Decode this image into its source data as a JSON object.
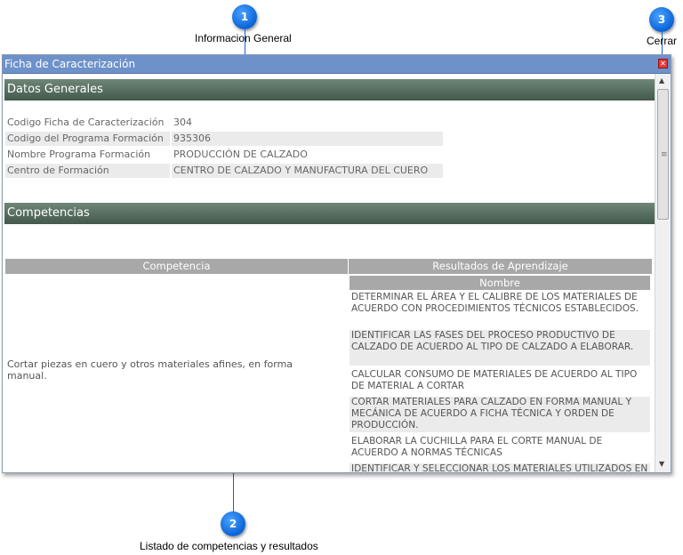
{
  "callouts": [
    {
      "number": "1",
      "label": "Informacion General"
    },
    {
      "number": "2",
      "label": "Listado de competencias y resultados"
    },
    {
      "number": "3",
      "label": "Cerrar"
    }
  ],
  "window": {
    "title": "Ficha de Caracterización",
    "close_glyph": "✕"
  },
  "datos_generales": {
    "header": "Datos Generales",
    "rows": [
      {
        "label": "Codigo Ficha de Caracterización",
        "value": "304"
      },
      {
        "label": "Codigo del Programa Formación",
        "value": "935306"
      },
      {
        "label": "Nombre Programa Formación",
        "value": "PRODUCCIÓN DE CALZADO"
      },
      {
        "label": "Centro de Formación",
        "value": "CENTRO DE CALZADO Y MANUFACTURA DEL CUERO"
      }
    ]
  },
  "competencias": {
    "header": "Competencias",
    "col_competencia": "Competencia",
    "col_resultados": "Resultados de Aprendizaje",
    "sub_col_nombre": "Nombre",
    "competencia": "Cortar piezas en cuero y otros materiales afines, en forma manual.",
    "resultados": [
      "DETERMINAR EL ÁREA Y EL CALIBRE DE LOS MATERIALES DE ACUERDO CON PROCEDIMIENTOS TÉCNICOS ESTABLECIDOS.",
      "IDENTIFICAR LAS FASES DEL PROCESO PRODUCTIVO DE CALZADO DE ACUERDO AL TIPO DE CALZADO A ELABORAR.",
      "CALCULAR CONSUMO DE MATERIALES DE ACUERDO AL TIPO DE MATERIAL A CORTAR",
      "CORTAR MATERIALES PARA CALZADO EN FORMA MANUAL Y MECÁNICA DE ACUERDO A FICHA TÉCNICA Y ORDEN DE PRODUCCIÓN.",
      "ELABORAR LA CUCHILLA PARA EL CORTE MANUAL DE ACUERDO A NORMAS TÉCNICAS",
      "IDENTIFICAR Y SELECCIONAR LOS MATERIALES UTILIZADOS EN EL PROCESO DE CALZADO DE ACUERDO"
    ]
  },
  "icons": {
    "scroll_up": "▲",
    "scroll_down": "▼",
    "grip": "≡"
  }
}
